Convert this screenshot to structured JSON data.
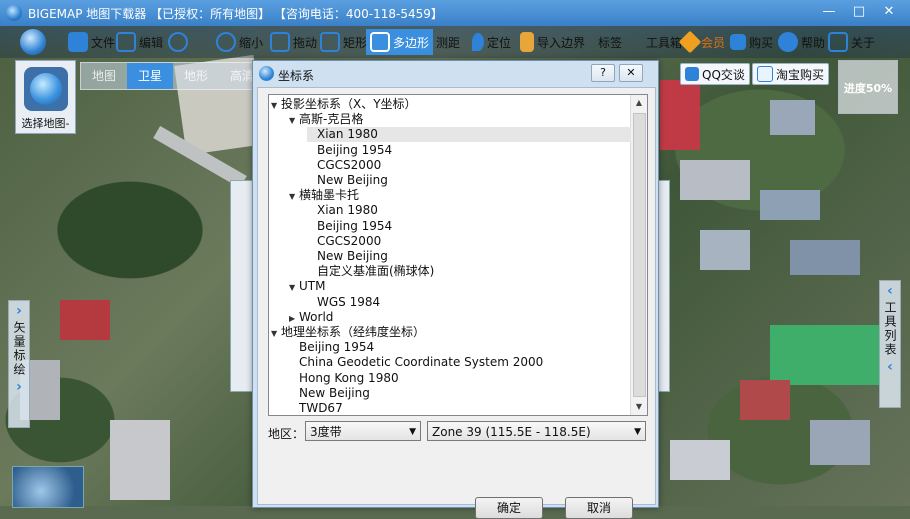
{
  "window": {
    "title": "BIGEMAP 地图下载器 【已授权：所有地图】 【咨询电话：400-118-5459】",
    "controls": [
      "—",
      "□",
      "✕"
    ]
  },
  "toolbar": {
    "items": [
      {
        "label": "文件",
        "icon": "file-icon"
      },
      {
        "label": "编辑",
        "icon": "edit-icon"
      },
      {
        "label": "",
        "icon": "search-icon"
      },
      {
        "label": "缩小",
        "icon": "zoom-out-icon"
      },
      {
        "label": "拖动",
        "icon": "hand-icon"
      },
      {
        "label": "矩形",
        "icon": "rectangle-icon"
      },
      {
        "label": "多边形",
        "icon": "polygon-icon",
        "active": true
      },
      {
        "label": "测距",
        "icon": "measure-icon"
      },
      {
        "label": "定位",
        "icon": "pin-icon"
      },
      {
        "label": "导入边界",
        "icon": "import-icon"
      },
      {
        "label": "标签",
        "icon": "tag-icon"
      },
      {
        "label": "工具箱",
        "icon": "toolbox-icon"
      },
      {
        "label": "会员",
        "icon": "vip-icon"
      },
      {
        "label": "购买",
        "icon": "cart-icon"
      },
      {
        "label": "帮助",
        "icon": "help-icon"
      },
      {
        "label": "关于",
        "icon": "about-icon"
      }
    ]
  },
  "map_tabs": {
    "items": [
      "地图",
      "卫星",
      "地形",
      "高清"
    ],
    "selected": "卫星"
  },
  "select_map": {
    "label": "选择地图-"
  },
  "contact": {
    "qq": "QQ交谈",
    "taobao": "淘宝购买"
  },
  "progress": {
    "label": "进度50%",
    "percent": 50
  },
  "left_panel": {
    "text": "矢量标绘"
  },
  "right_panel": {
    "text": "工具列表"
  },
  "dialog": {
    "title": "坐标系",
    "help": "?",
    "close": "✕",
    "tree": [
      {
        "level": 0,
        "expand": "▼",
        "label": "投影坐标系（X、Y坐标）"
      },
      {
        "level": 1,
        "expand": "▼",
        "label": "高斯-克吕格"
      },
      {
        "level": 2,
        "label": "Xian 1980",
        "selected": true
      },
      {
        "level": 2,
        "label": "Beijing 1954"
      },
      {
        "level": 2,
        "label": "CGCS2000"
      },
      {
        "level": 2,
        "label": "New Beijing"
      },
      {
        "level": 1,
        "expand": "▼",
        "label": "横轴墨卡托"
      },
      {
        "level": 2,
        "label": "Xian 1980"
      },
      {
        "level": 2,
        "label": "Beijing 1954"
      },
      {
        "level": 2,
        "label": "CGCS2000"
      },
      {
        "level": 2,
        "label": "New Beijing"
      },
      {
        "level": 2,
        "label": "自定义基准面(椭球体)"
      },
      {
        "level": 1,
        "expand": "▼",
        "label": "UTM"
      },
      {
        "level": 2,
        "label": "WGS 1984"
      },
      {
        "level": 1,
        "expand": "▶",
        "label": "World"
      },
      {
        "level": 0,
        "expand": "▼",
        "label": "地理坐标系（经纬度坐标）"
      },
      {
        "level": 1,
        "label": "Beijing 1954"
      },
      {
        "level": 1,
        "label": "China Geodetic Coordinate System 2000"
      },
      {
        "level": 1,
        "label": "Hong Kong 1980"
      },
      {
        "level": 1,
        "label": "New Beijing"
      },
      {
        "level": 1,
        "label": "TWD67"
      }
    ],
    "region_label": "地区：",
    "band_select": "3度带",
    "zone_select": "Zone 39 (115.5E - 118.5E)",
    "ok": "确定",
    "cancel": "取消"
  },
  "colors": {
    "accent": "#3b8fe0",
    "title_bar": "#4a90d8",
    "dialog_frame": "#cfe0f0",
    "cursor": "#e02020"
  }
}
